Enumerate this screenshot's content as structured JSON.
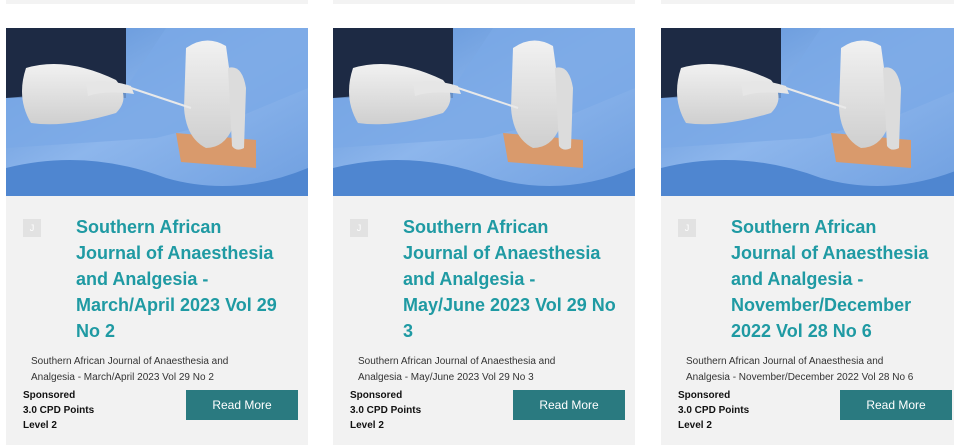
{
  "cards": [
    {
      "title": "Southern African Journal of Anaesthesia and Analgesia - March/April 2023 Vol 29 No 2",
      "description": "Southern African Journal of Anaesthesia and Analgesia - March/April 2023 Vol 29 No 2",
      "sponsored": "Sponsored",
      "cpd": "3.0 CPD Points",
      "level": "Level 2",
      "button": "Read More",
      "icon_glyph": "J",
      "icon": "journal-icon",
      "image": "gloved-hands-injection-photo"
    },
    {
      "title": "Southern African Journal of Anaesthesia and Analgesia - May/June 2023 Vol 29 No 3",
      "description": "Southern African Journal of Anaesthesia and Analgesia - May/June 2023 Vol 29 No 3",
      "sponsored": "Sponsored",
      "cpd": "3.0 CPD Points",
      "level": "Level 2",
      "button": "Read More",
      "icon_glyph": "J",
      "icon": "journal-icon",
      "image": "gloved-hands-injection-photo"
    },
    {
      "title": "Southern African Journal of Anaesthesia and Analgesia - November/December 2022 Vol 28 No 6",
      "description": "Southern African Journal of Anaesthesia and Analgesia - November/December 2022 Vol 28 No 6",
      "sponsored": "Sponsored",
      "cpd": "3.0 CPD Points",
      "level": "Level 2",
      "button": "Read More",
      "icon_glyph": "J",
      "icon": "journal-icon",
      "image": "gloved-hands-injection-photo"
    }
  ],
  "colors": {
    "title": "#1f9aa3",
    "button": "#2a7a80",
    "card_bg": "#f2f2f2"
  }
}
